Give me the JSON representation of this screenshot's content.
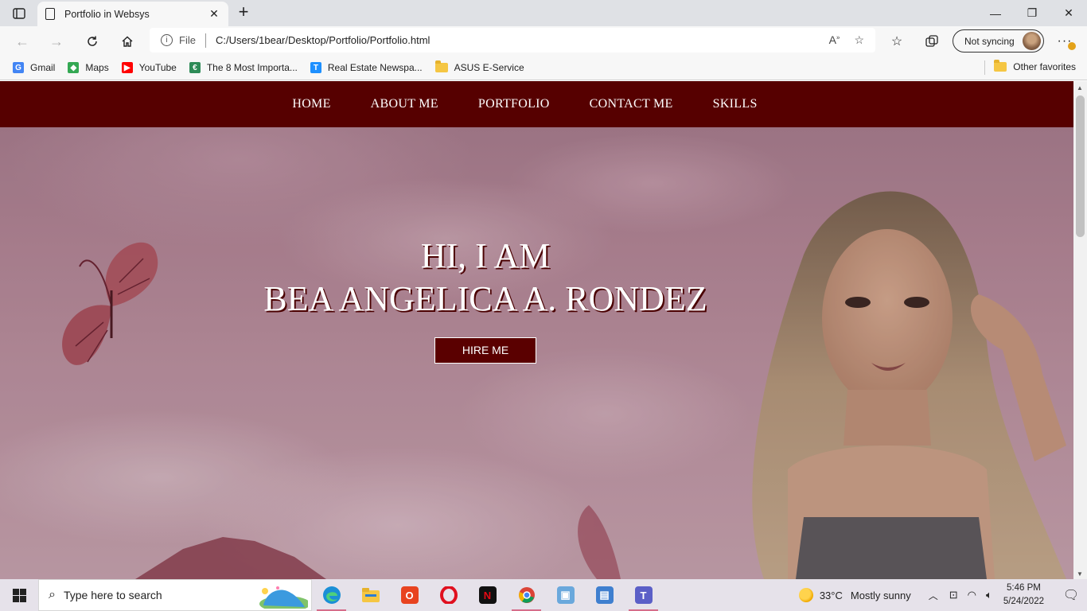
{
  "browser": {
    "tab_title": "Portfolio in Websys",
    "tab_close": "✕",
    "new_tab": "+",
    "window_controls": {
      "minimize": "—",
      "restore": "❐",
      "close": "✕"
    },
    "address": {
      "scheme": "File",
      "url": "C:/Users/1bear/Desktop/Portfolio/Portfolio.html"
    },
    "sync_label": "Not syncing",
    "more_label": "···",
    "bookmarks": [
      {
        "label": "Gmail",
        "icon": "google-icon",
        "color": "#4285f4",
        "glyph": "G"
      },
      {
        "label": "Maps",
        "icon": "maps-pin-icon",
        "color": "#34a853",
        "glyph": "◆"
      },
      {
        "label": "YouTube",
        "icon": "youtube-icon",
        "color": "#ff0000",
        "glyph": "▶"
      },
      {
        "label": "The 8 Most Importa...",
        "icon": "site-favicon-icon",
        "color": "#2e8b57",
        "glyph": "€"
      },
      {
        "label": "Real Estate Newspa...",
        "icon": "t-favicon-icon",
        "color": "#1e90ff",
        "glyph": "T"
      },
      {
        "label": "ASUS E-Service",
        "icon": "folder-icon",
        "color": "#f5c643",
        "glyph": ""
      }
    ],
    "other_favorites": "Other favorites"
  },
  "site": {
    "nav": [
      "HOME",
      "ABOUT ME",
      "PORTFOLIO",
      "CONTACT ME",
      "SKILLS"
    ],
    "hero_line1": "HI, I AM",
    "hero_line2": "BEA ANGELICA A. RONDEZ",
    "hire_button": "HIRE ME",
    "nav_color": "#560000"
  },
  "taskbar": {
    "search_placeholder": "Type here to search",
    "weather": "33°C",
    "weather_desc": "Mostly sunny",
    "time": "5:46 PM",
    "date": "5/24/2022"
  }
}
